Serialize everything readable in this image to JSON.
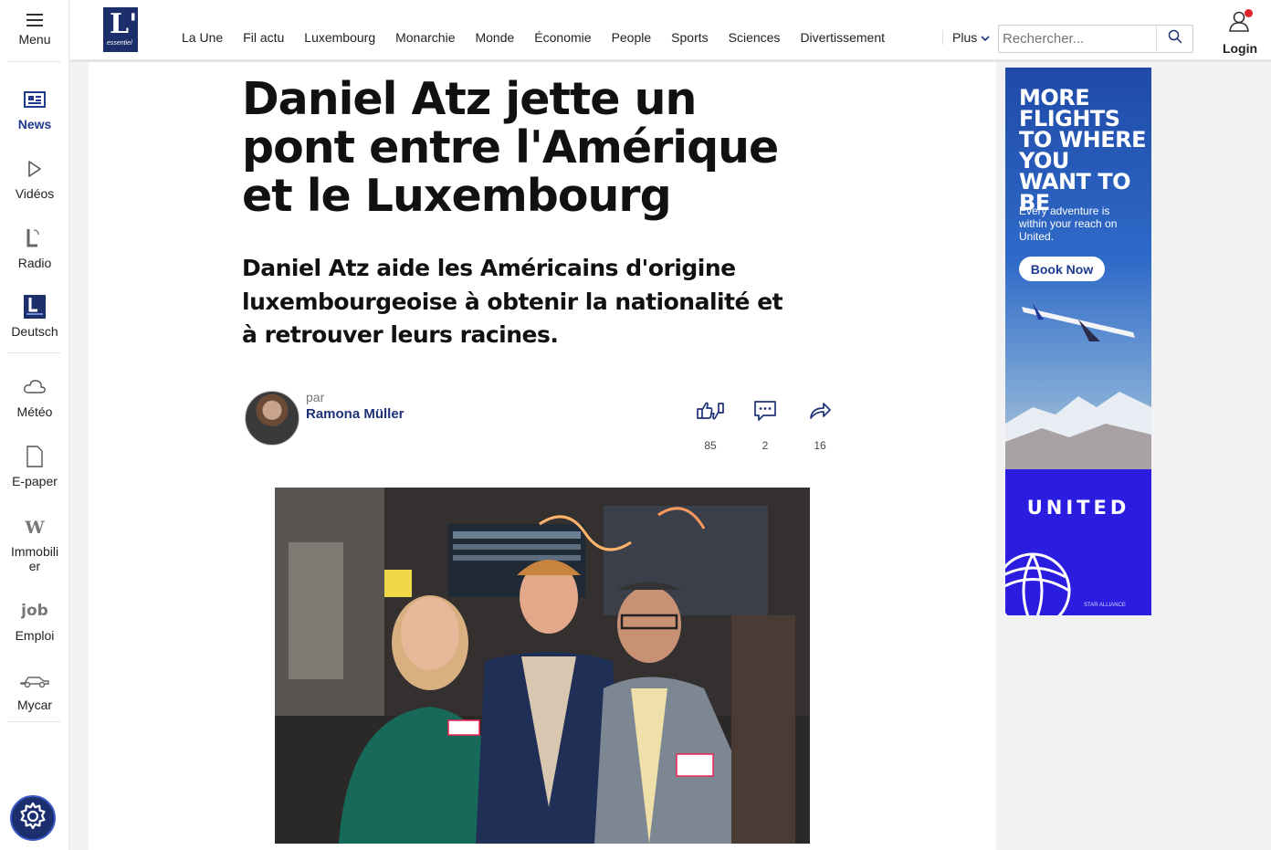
{
  "sidebar": {
    "menu_label": "Menu",
    "items": [
      {
        "label": "News",
        "icon": "newspaper-icon",
        "active": true
      },
      {
        "label": "Vidéos",
        "icon": "play-icon"
      },
      {
        "label": "Radio",
        "icon": "radio-logo-icon"
      },
      {
        "label": "Deutsch",
        "icon": "lessentiel-de-logo-icon"
      },
      {
        "label": "Météo",
        "icon": "cloud-icon"
      },
      {
        "label": "E-paper",
        "icon": "page-icon"
      },
      {
        "label": "Immobili\ner",
        "icon": "w-logo-icon"
      },
      {
        "label": "Emploi",
        "icon": "job-logo-icon"
      },
      {
        "label": "Mycar",
        "icon": "car-icon"
      }
    ],
    "settings_icon": "gear-icon"
  },
  "header": {
    "logo_letter": "L'",
    "logo_word": "essentiel",
    "nav": [
      "La Une",
      "Fil actu",
      "Luxembourg",
      "Monarchie",
      "Monde",
      "Économie",
      "People",
      "Sports",
      "Sciences",
      "Divertissement"
    ],
    "more_label": "Plus",
    "search_placeholder": "Rechercher...",
    "login_label": "Login"
  },
  "article": {
    "title": "Daniel Atz jette un pont entre l'Amérique et le Luxembourg",
    "lead": "Daniel Atz aide les Américains d'origine luxembourgeoise à obtenir la nationalité et à retrouver leurs racines.",
    "author_prefix": "par",
    "author_name": "Ramona Müller",
    "reactions": "85",
    "comments": "2",
    "shares": "16"
  },
  "ad": {
    "headline": "MORE FLIGHTS TO WHERE YOU WANT TO BE",
    "subline": "Every adventure is within your reach on United.",
    "cta": "Book Now",
    "brand": "UNITED",
    "alliance": "STAR ALLIANCE",
    "colors": {
      "top": "#1f4aa8",
      "bottom": "#2b1de0"
    }
  },
  "colors": {
    "accent": "#1f3278",
    "brand_navy": "#1c2f6b"
  }
}
